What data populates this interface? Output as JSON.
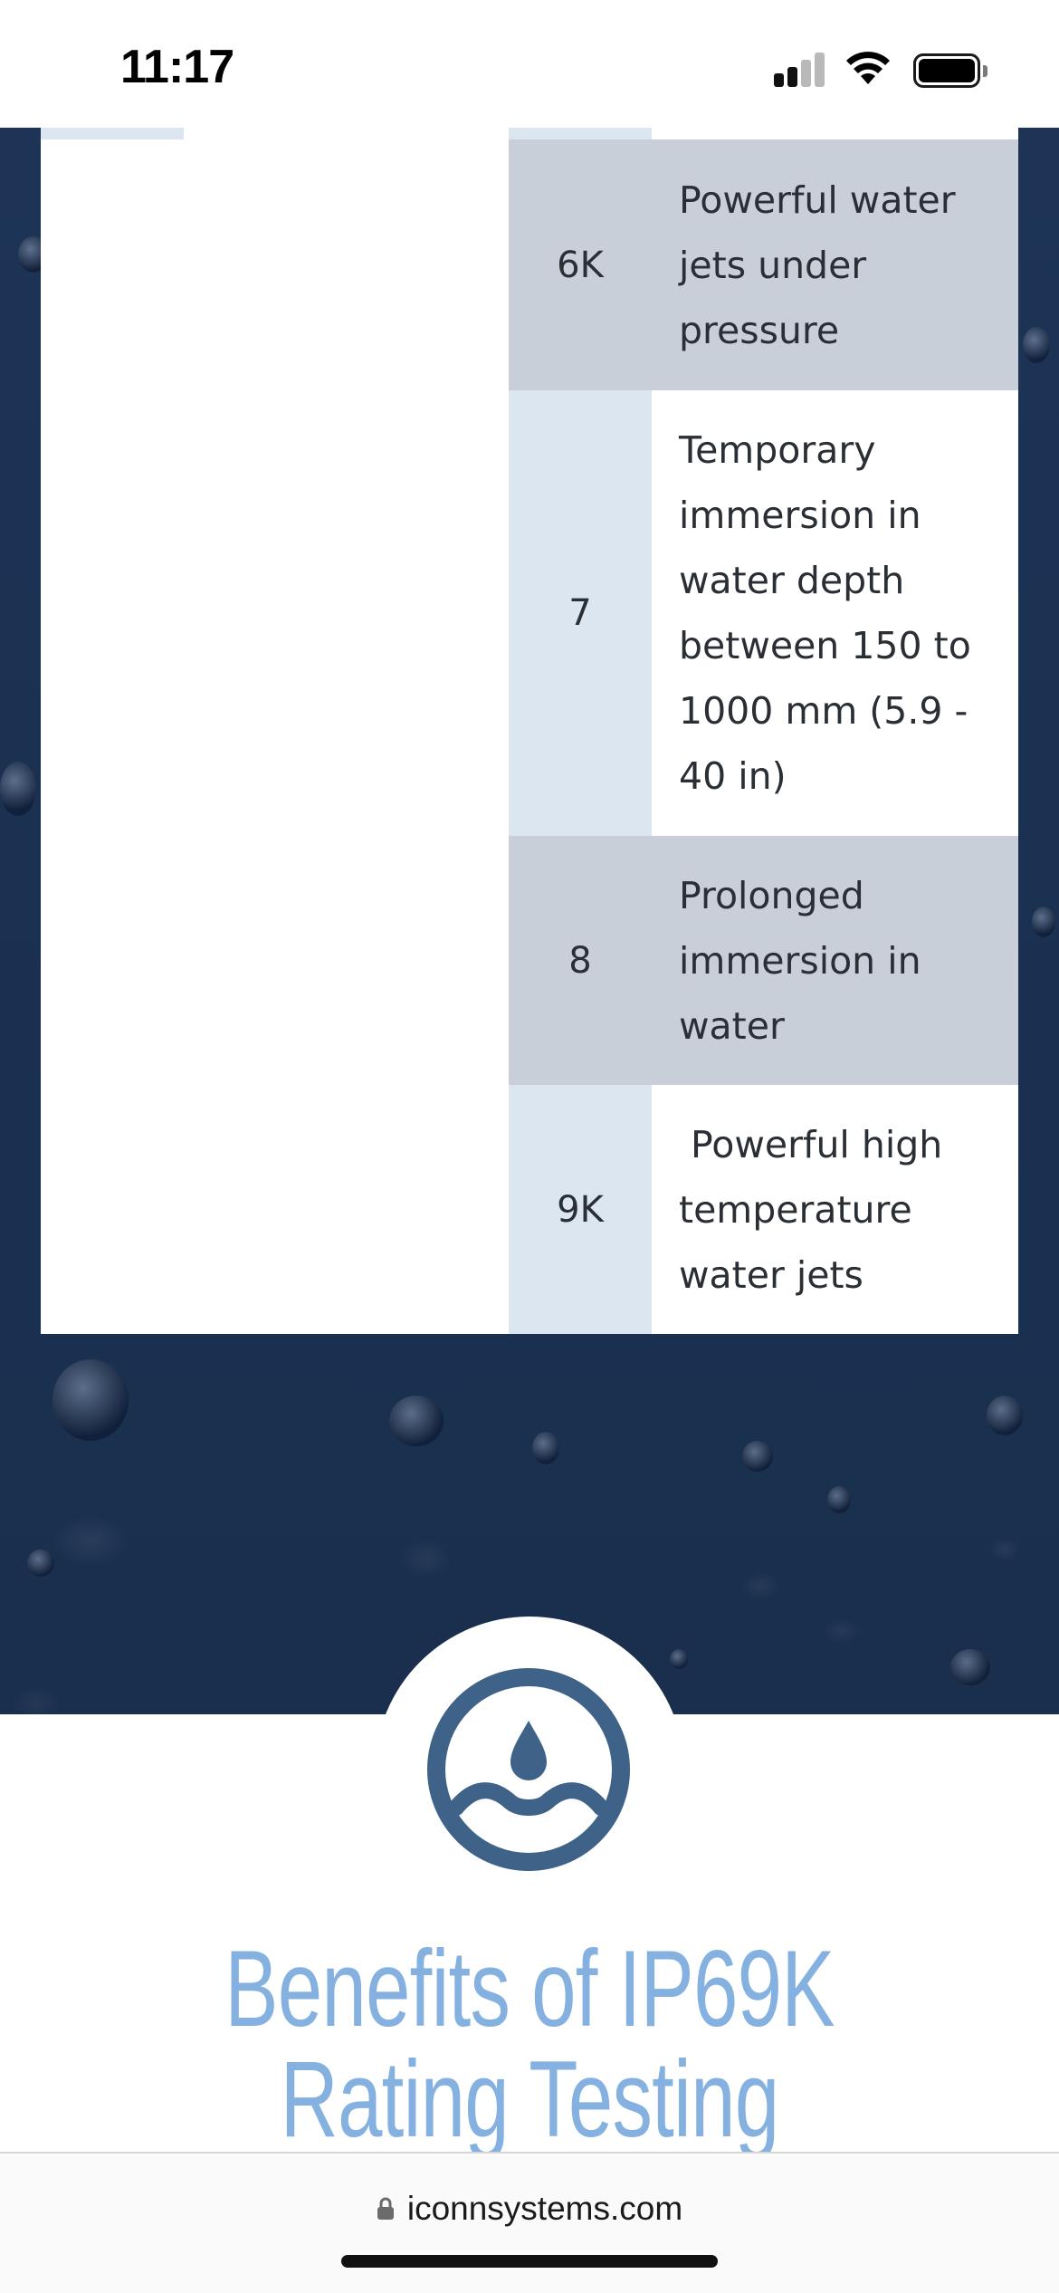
{
  "status_bar": {
    "time": "11:17"
  },
  "ip_table": {
    "rows": [
      {
        "code": "6K",
        "description": "Powerful water jets under pressure",
        "shade": "dark"
      },
      {
        "code": "7",
        "description": "Temporary immersion in water depth between 150 to 1000 mm (5.9 - 40 in)",
        "shade": "light"
      },
      {
        "code": "8",
        "description": "Prolonged immersion in water",
        "shade": "dark"
      },
      {
        "code": "9K",
        "description": " Powerful high temperature water jets",
        "shade": "light"
      }
    ]
  },
  "benefits": {
    "icon": "water-drop-wave-icon",
    "heading": "Benefits of IP69K Rating Testing"
  },
  "browser": {
    "url": "iconnsystems.com",
    "lock_icon": "lock-icon"
  },
  "colors": {
    "heading_blue": "#85b1e0",
    "icon_blue": "#3f6288",
    "background_navy": "#1b3152",
    "row_dark": "#c8cfd8",
    "row_light_code": "#dce6f0"
  }
}
